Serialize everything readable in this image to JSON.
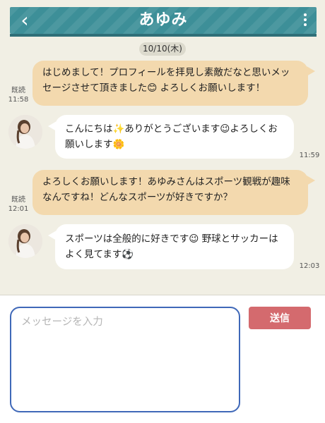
{
  "header": {
    "title": "あゆみ",
    "back_icon": "chevron-left-icon",
    "menu_icon": "vertical-dots-icon"
  },
  "date_separator": "10/10(木)",
  "messages": [
    {
      "direction": "outgoing",
      "text": "はじめまして！プロフィールを拝見し素敵だなと思いメッセージさせて頂きました😊 よろしくお願いします！",
      "read_label": "既読",
      "time": "11:58"
    },
    {
      "direction": "incoming",
      "text": "こんにちは✨ありがとうございます😉よろしくお願いします🌼",
      "time": "11:59"
    },
    {
      "direction": "outgoing",
      "text": "よろしくお願いします！あゆみさんはスポーツ観戦が趣味なんですね！どんなスポーツが好きですか？",
      "read_label": "既読",
      "time": "12:01"
    },
    {
      "direction": "incoming",
      "text": "スポーツは全般的に好きです😉 野球とサッカーはよく見てます⚽",
      "time": "12:03"
    }
  ],
  "composer": {
    "placeholder": "メッセージを入力",
    "value": "",
    "send_label": "送信"
  },
  "colors": {
    "header": "#3d8f98",
    "background": "#f1efe4",
    "outgoing_bubble": "#f3d9ae",
    "incoming_bubble": "#ffffff",
    "send_button": "#d46a6e",
    "input_border": "#3f68b8"
  }
}
